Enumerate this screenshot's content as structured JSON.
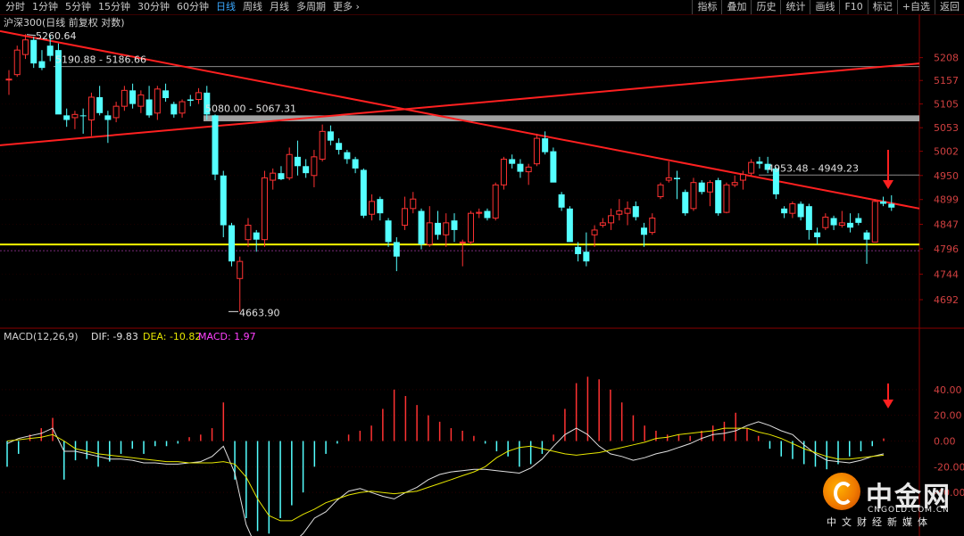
{
  "toolbar": {
    "periods": [
      "分时",
      "1分钟",
      "5分钟",
      "15分钟",
      "30分钟",
      "60分钟",
      "日线",
      "周线",
      "月线",
      "多周期",
      "更多"
    ],
    "active_period": "日线",
    "more_arrow": "›",
    "tools": [
      "指标",
      "叠加",
      "历史",
      "统计",
      "画线",
      "F10",
      "标记",
      "+自选",
      "返回"
    ]
  },
  "main_panel": {
    "title": "沪深300(日线 前复权 对数)",
    "high_label": "5260.64",
    "low_label": "4663.90",
    "range_labels": [
      "5190.88 - 5186.66",
      "5080.00 - 5067.31",
      "4953.48 - 4949.23"
    ],
    "ticks": [
      5208,
      5157,
      5105,
      5053,
      5002,
      4950,
      4899,
      4847,
      4796,
      4744,
      4692
    ]
  },
  "macd_panel": {
    "title": "MACD(12,26,9)",
    "dif_text": "DIF: -9.83",
    "dea_text": "DEA: -10.82",
    "macd_text": "MACD: 1.97",
    "ticks": [
      "40.00",
      "20.00",
      "0.00",
      "-20.00",
      "-40.00"
    ]
  },
  "colors": {
    "up": "#ff3232",
    "down": "#54ffff",
    "trend_line": "#ff2020",
    "support_line": "#ffff00",
    "resistance_band": "#a0a0a0",
    "dif_line": "#e0e0e0",
    "dea_line": "#e6e600",
    "macd_label": "#ff40ff"
  },
  "watermark": {
    "name": "中金网",
    "url": "CNGOLD.COM.CN",
    "slogan": "中文财经新媒体"
  },
  "chart_data": {
    "type": "candlestick",
    "title": "沪深300(日线 前复权 对数)",
    "y_range": [
      4640,
      5290
    ],
    "candles": [
      {
        "o": 5160,
        "h": 5180,
        "l": 5125,
        "c": 5160
      },
      {
        "o": 5170,
        "h": 5235,
        "l": 5165,
        "c": 5225
      },
      {
        "o": 5215,
        "h": 5261,
        "l": 5205,
        "c": 5248
      },
      {
        "o": 5248,
        "h": 5255,
        "l": 5185,
        "c": 5195
      },
      {
        "o": 5200,
        "h": 5225,
        "l": 5180,
        "c": 5185
      },
      {
        "o": 5235,
        "h": 5258,
        "l": 5200,
        "c": 5212
      },
      {
        "o": 5225,
        "h": 5240,
        "l": 5120,
        "c": 5082
      },
      {
        "o": 5080,
        "h": 5095,
        "l": 5055,
        "c": 5070
      },
      {
        "o": 5075,
        "h": 5090,
        "l": 5050,
        "c": 5082
      },
      {
        "o": 5080,
        "h": 5095,
        "l": 5040,
        "c": 5078
      },
      {
        "o": 5070,
        "h": 5130,
        "l": 5035,
        "c": 5120
      },
      {
        "o": 5120,
        "h": 5145,
        "l": 5080,
        "c": 5085
      },
      {
        "o": 5080,
        "h": 5090,
        "l": 5020,
        "c": 5070
      },
      {
        "o": 5075,
        "h": 5110,
        "l": 5065,
        "c": 5100
      },
      {
        "o": 5100,
        "h": 5145,
        "l": 5090,
        "c": 5135
      },
      {
        "o": 5135,
        "h": 5150,
        "l": 5095,
        "c": 5105
      },
      {
        "o": 5100,
        "h": 5135,
        "l": 5085,
        "c": 5125
      },
      {
        "o": 5115,
        "h": 5145,
        "l": 5075,
        "c": 5080
      },
      {
        "o": 5085,
        "h": 5145,
        "l": 5070,
        "c": 5138
      },
      {
        "o": 5135,
        "h": 5150,
        "l": 5110,
        "c": 5118
      },
      {
        "o": 5105,
        "h": 5110,
        "l": 5075,
        "c": 5082
      },
      {
        "o": 5085,
        "h": 5115,
        "l": 5075,
        "c": 5110
      },
      {
        "o": 5115,
        "h": 5125,
        "l": 5100,
        "c": 5112
      },
      {
        "o": 5115,
        "h": 5140,
        "l": 5105,
        "c": 5130
      },
      {
        "o": 5130,
        "h": 5145,
        "l": 5070,
        "c": 5082
      },
      {
        "o": 5080,
        "h": 5082,
        "l": 4940,
        "c": 4952
      },
      {
        "o": 4950,
        "h": 4960,
        "l": 4820,
        "c": 4845
      },
      {
        "o": 4845,
        "h": 4850,
        "l": 4760,
        "c": 4770
      },
      {
        "o": 4735,
        "h": 4780,
        "l": 4668,
        "c": 4770
      },
      {
        "o": 4815,
        "h": 4860,
        "l": 4800,
        "c": 4845
      },
      {
        "o": 4830,
        "h": 4835,
        "l": 4790,
        "c": 4815
      },
      {
        "o": 4815,
        "h": 4960,
        "l": 4800,
        "c": 4945
      },
      {
        "o": 4940,
        "h": 4965,
        "l": 4920,
        "c": 4955
      },
      {
        "o": 4955,
        "h": 4970,
        "l": 4940,
        "c": 4942
      },
      {
        "o": 4945,
        "h": 5010,
        "l": 4940,
        "c": 4995
      },
      {
        "o": 4990,
        "h": 5025,
        "l": 4950,
        "c": 4970
      },
      {
        "o": 4970,
        "h": 4985,
        "l": 4945,
        "c": 4955
      },
      {
        "o": 4950,
        "h": 5005,
        "l": 4925,
        "c": 4990
      },
      {
        "o": 4985,
        "h": 5060,
        "l": 4980,
        "c": 5045
      },
      {
        "o": 5045,
        "h": 5058,
        "l": 5015,
        "c": 5025
      },
      {
        "o": 5020,
        "h": 5030,
        "l": 4995,
        "c": 5005
      },
      {
        "o": 5000,
        "h": 5005,
        "l": 4975,
        "c": 4985
      },
      {
        "o": 4985,
        "h": 4990,
        "l": 4955,
        "c": 4965
      },
      {
        "o": 4962,
        "h": 4965,
        "l": 4860,
        "c": 4865
      },
      {
        "o": 4868,
        "h": 4910,
        "l": 4855,
        "c": 4895
      },
      {
        "o": 4900,
        "h": 4905,
        "l": 4855,
        "c": 4870
      },
      {
        "o": 4855,
        "h": 4860,
        "l": 4800,
        "c": 4810
      },
      {
        "o": 4810,
        "h": 4820,
        "l": 4750,
        "c": 4780
      },
      {
        "o": 4845,
        "h": 4905,
        "l": 4835,
        "c": 4880
      },
      {
        "o": 4880,
        "h": 4915,
        "l": 4870,
        "c": 4900
      },
      {
        "o": 4875,
        "h": 4880,
        "l": 4795,
        "c": 4805
      },
      {
        "o": 4805,
        "h": 4885,
        "l": 4800,
        "c": 4850
      },
      {
        "o": 4850,
        "h": 4875,
        "l": 4815,
        "c": 4825
      },
      {
        "o": 4825,
        "h": 4870,
        "l": 4800,
        "c": 4850
      },
      {
        "o": 4855,
        "h": 4870,
        "l": 4810,
        "c": 4835
      },
      {
        "o": 4810,
        "h": 4815,
        "l": 4760,
        "c": 4810
      },
      {
        "o": 4810,
        "h": 4875,
        "l": 4805,
        "c": 4870
      },
      {
        "o": 4870,
        "h": 4880,
        "l": 4860,
        "c": 4872
      },
      {
        "o": 4875,
        "h": 4880,
        "l": 4855,
        "c": 4860
      },
      {
        "o": 4860,
        "h": 4935,
        "l": 4855,
        "c": 4930
      },
      {
        "o": 4930,
        "h": 4990,
        "l": 4920,
        "c": 4985
      },
      {
        "o": 4985,
        "h": 4995,
        "l": 4965,
        "c": 4975
      },
      {
        "o": 4975,
        "h": 4985,
        "l": 4945,
        "c": 4958
      },
      {
        "o": 4958,
        "h": 4975,
        "l": 4930,
        "c": 4968
      },
      {
        "o": 4975,
        "h": 5040,
        "l": 4970,
        "c": 5030
      },
      {
        "o": 5030,
        "h": 5045,
        "l": 4995,
        "c": 5000
      },
      {
        "o": 5002,
        "h": 5010,
        "l": 4940,
        "c": 4935
      },
      {
        "o": 4910,
        "h": 4915,
        "l": 4875,
        "c": 4882
      },
      {
        "o": 4880,
        "h": 4885,
        "l": 4820,
        "c": 4810
      },
      {
        "o": 4800,
        "h": 4810,
        "l": 4770,
        "c": 4785
      },
      {
        "o": 4790,
        "h": 4830,
        "l": 4760,
        "c": 4770
      },
      {
        "o": 4825,
        "h": 4845,
        "l": 4800,
        "c": 4835
      },
      {
        "o": 4845,
        "h": 4860,
        "l": 4840,
        "c": 4850
      },
      {
        "o": 4850,
        "h": 4880,
        "l": 4835,
        "c": 4865
      },
      {
        "o": 4868,
        "h": 4900,
        "l": 4855,
        "c": 4875
      },
      {
        "o": 4870,
        "h": 4895,
        "l": 4845,
        "c": 4880
      },
      {
        "o": 4885,
        "h": 4895,
        "l": 4855,
        "c": 4862
      },
      {
        "o": 4840,
        "h": 4850,
        "l": 4800,
        "c": 4825
      },
      {
        "o": 4830,
        "h": 4870,
        "l": 4825,
        "c": 4860
      },
      {
        "o": 4905,
        "h": 4935,
        "l": 4900,
        "c": 4930
      },
      {
        "o": 4940,
        "h": 4980,
        "l": 4935,
        "c": 4945
      },
      {
        "o": 4945,
        "h": 4960,
        "l": 4900,
        "c": 4942
      },
      {
        "o": 4915,
        "h": 4920,
        "l": 4865,
        "c": 4870
      },
      {
        "o": 4880,
        "h": 4945,
        "l": 4875,
        "c": 4935
      },
      {
        "o": 4935,
        "h": 4940,
        "l": 4910,
        "c": 4915
      },
      {
        "o": 4915,
        "h": 4940,
        "l": 4885,
        "c": 4935
      },
      {
        "o": 4940,
        "h": 4945,
        "l": 4865,
        "c": 4870
      },
      {
        "o": 4872,
        "h": 4935,
        "l": 4870,
        "c": 4930
      },
      {
        "o": 4930,
        "h": 4950,
        "l": 4925,
        "c": 4935
      },
      {
        "o": 4940,
        "h": 4960,
        "l": 4920,
        "c": 4952
      },
      {
        "o": 4955,
        "h": 4985,
        "l": 4950,
        "c": 4978
      },
      {
        "o": 4980,
        "h": 4990,
        "l": 4965,
        "c": 4975
      },
      {
        "o": 4975,
        "h": 4990,
        "l": 4955,
        "c": 4962
      },
      {
        "o": 4965,
        "h": 4968,
        "l": 4900,
        "c": 4910
      },
      {
        "o": 4880,
        "h": 4885,
        "l": 4860,
        "c": 4870
      },
      {
        "o": 4870,
        "h": 4895,
        "l": 4860,
        "c": 4890
      },
      {
        "o": 4890,
        "h": 4895,
        "l": 4855,
        "c": 4862
      },
      {
        "o": 4885,
        "h": 4890,
        "l": 4815,
        "c": 4835
      },
      {
        "o": 4830,
        "h": 4840,
        "l": 4805,
        "c": 4820
      },
      {
        "o": 4840,
        "h": 4870,
        "l": 4835,
        "c": 4862
      },
      {
        "o": 4860,
        "h": 4865,
        "l": 4835,
        "c": 4845
      },
      {
        "o": 4845,
        "h": 4875,
        "l": 4840,
        "c": 4850
      },
      {
        "o": 4850,
        "h": 4870,
        "l": 4830,
        "c": 4840
      },
      {
        "o": 4860,
        "h": 4870,
        "l": 4845,
        "c": 4850
      },
      {
        "o": 4830,
        "h": 4835,
        "l": 4765,
        "c": 4815
      },
      {
        "o": 4810,
        "h": 4900,
        "l": 4810,
        "c": 4895
      },
      {
        "o": 4895,
        "h": 4905,
        "l": 4885,
        "c": 4890
      },
      {
        "o": 4890,
        "h": 4908,
        "l": 4875,
        "c": 4882
      }
    ],
    "horizontal_levels": {
      "support": 4805,
      "dashed": 4792
    },
    "macd": {
      "dif": [
        -2,
        2,
        4,
        6,
        10,
        -8,
        -8,
        -10,
        -12,
        -14,
        -14,
        -15,
        -17,
        -17,
        -18,
        -18,
        -17,
        -16,
        -12,
        -4,
        -25,
        -65,
        -85,
        -92,
        -85,
        -80,
        -72,
        -60,
        -55,
        -46,
        -39,
        -37,
        -40,
        -43,
        -45,
        -40,
        -36,
        -30,
        -26,
        -24,
        -23,
        -22,
        -22,
        -23,
        -24,
        -25,
        -21,
        -14,
        -4,
        5,
        10,
        5,
        -4,
        -10,
        -12,
        -15,
        -13,
        -10,
        -8,
        -5,
        -2,
        2,
        5,
        6,
        8,
        12,
        15,
        12,
        8,
        5,
        -3,
        -10,
        -15,
        -16,
        -17,
        -15,
        -12,
        -10
      ],
      "dea": [
        0,
        1,
        2,
        3,
        5,
        0,
        -6,
        -8,
        -10,
        -11,
        -12,
        -13,
        -14,
        -15,
        -16,
        -16,
        -17,
        -17,
        -17,
        -16,
        -18,
        -28,
        -45,
        -58,
        -62,
        -62,
        -57,
        -53,
        -48,
        -45,
        -42,
        -40,
        -39,
        -40,
        -41,
        -40,
        -39,
        -36,
        -33,
        -30,
        -27,
        -24,
        -20,
        -13,
        -8,
        -5,
        -4,
        -6,
        -8,
        -10,
        -11,
        -10,
        -9,
        -7,
        -5,
        -3,
        -1,
        2,
        3,
        5,
        6,
        7,
        8,
        10,
        10,
        10,
        7,
        5,
        2,
        -2,
        -6,
        -9,
        -12,
        -14,
        -14,
        -13,
        -12,
        -11
      ],
      "hist": [
        -20,
        -10,
        5,
        10,
        18,
        -30,
        -15,
        -14,
        -20,
        -16,
        -10,
        -6,
        -10,
        -4,
        -4,
        -2,
        3,
        5,
        10,
        30,
        -30,
        -60,
        -70,
        -72,
        -60,
        -50,
        -40,
        -20,
        -10,
        -2,
        5,
        8,
        12,
        25,
        40,
        35,
        28,
        20,
        15,
        10,
        8,
        4,
        -2,
        -8,
        -12,
        -20,
        -18,
        -10,
        5,
        25,
        45,
        50,
        48,
        40,
        30,
        20,
        12,
        8,
        5,
        5,
        4,
        8,
        12,
        15,
        22,
        10,
        4,
        -6,
        -12,
        -14,
        -18,
        -20,
        -22,
        -18,
        -12,
        -8,
        -4,
        2
      ],
      "ylim": [
        -60,
        60
      ]
    }
  }
}
